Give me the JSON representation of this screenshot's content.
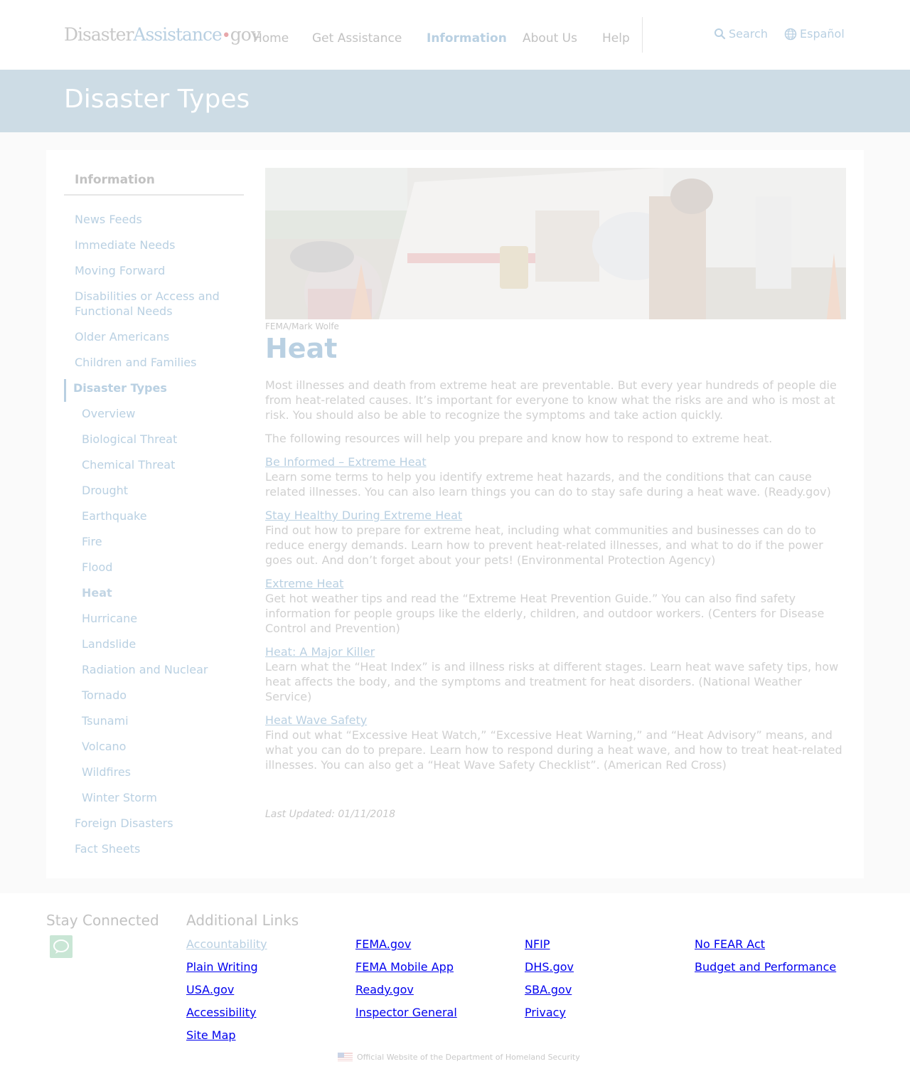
{
  "header": {
    "logo": {
      "part1": "Disaster",
      "part2": "Assistance",
      "dot": "•",
      "part3": "gov"
    },
    "nav": [
      "Home",
      "Get Assistance",
      "Information",
      "About Us",
      "Help"
    ],
    "search_label": "Search",
    "language_label": "Español"
  },
  "banner": {
    "title": "Disaster Types"
  },
  "sidebar": {
    "title": "Information",
    "items": [
      {
        "label": "News Feeds",
        "level": "top"
      },
      {
        "label": "Immediate Needs",
        "level": "top"
      },
      {
        "label": "Moving Forward",
        "level": "top"
      },
      {
        "label": "Disabilities or Access and Functional Needs",
        "level": "top"
      },
      {
        "label": "Older Americans",
        "level": "top"
      },
      {
        "label": "Children and Families",
        "level": "top"
      },
      {
        "label": "Disaster Types",
        "level": "current"
      },
      {
        "label": "Overview",
        "level": "sub"
      },
      {
        "label": "Biological Threat",
        "level": "sub"
      },
      {
        "label": "Chemical Threat",
        "level": "sub"
      },
      {
        "label": "Drought",
        "level": "sub"
      },
      {
        "label": "Earthquake",
        "level": "sub"
      },
      {
        "label": "Fire",
        "level": "sub"
      },
      {
        "label": "Flood",
        "level": "sub"
      },
      {
        "label": "Heat",
        "level": "sub-active"
      },
      {
        "label": "Hurricane",
        "level": "sub"
      },
      {
        "label": "Landslide",
        "level": "sub"
      },
      {
        "label": "Radiation and Nuclear",
        "level": "sub"
      },
      {
        "label": "Tornado",
        "level": "sub"
      },
      {
        "label": "Tsunami",
        "level": "sub"
      },
      {
        "label": "Volcano",
        "level": "sub"
      },
      {
        "label": "Wildfires",
        "level": "sub"
      },
      {
        "label": "Winter Storm",
        "level": "sub"
      },
      {
        "label": "Foreign Disasters",
        "level": "top"
      },
      {
        "label": "Fact Sheets",
        "level": "top"
      }
    ]
  },
  "main": {
    "photo_credit": "FEMA/Mark Wolfe",
    "heading": "Heat",
    "intro": "Most illnesses and death from extreme heat are preventable. But every year hundreds of people die from heat-related causes. It’s important for everyone to know what the risks are and who is most at risk. You should also be able to recognize the symptoms and take action quickly.",
    "resources_intro": "The following resources will help you prepare and know how to respond to extreme heat.",
    "resources": [
      {
        "title": "Be Informed – Extreme Heat",
        "desc": "Learn some terms to help you identify extreme heat hazards, and the conditions that can cause related illnesses. You can also learn things you can do to stay safe during a heat wave. (Ready.gov)"
      },
      {
        "title": "Stay Healthy During Extreme Heat",
        "desc": "Find out how to prepare for extreme heat, including what communities and businesses can do to reduce energy demands. Learn how to prevent heat-related illnesses, and what to do if the power goes out. And don’t forget about your pets! (Environmental Protection Agency)"
      },
      {
        "title": "Extreme Heat",
        "desc": "Get hot weather tips and read the “Extreme Heat Prevention Guide.” You can also find safety information for people groups like the elderly, children, and outdoor workers. (Centers for Disease Control and Prevention)"
      },
      {
        "title": "Heat: A Major Killer",
        "desc": "Learn what the “Heat Index” is and illness risks at different stages. Learn heat wave safety tips, how heat affects the body, and the symptoms and treatment for heat disorders. (National Weather Service)"
      },
      {
        "title": "Heat Wave Safety",
        "desc": "Find out what “Excessive Heat Watch,” “Excessive Heat Warning,” and “Heat Advisory” means, and what you can do to prepare. Learn how to respond during a heat wave, and how to treat heat-related illnesses. You can also get a “Heat Wave Safety Checklist”. (American Red Cross)"
      }
    ],
    "last_updated": "Last Updated: 01/11/2018"
  },
  "footer": {
    "stay_connected": "Stay Connected",
    "additional_links": "Additional Links",
    "links": {
      "accountability": "Accountability",
      "plain_writing": "Plain Writing",
      "usa_gov": "USA.gov",
      "accessibility": "Accessibility",
      "site_map": "Site Map",
      "fema_gov": "FEMA.gov",
      "fema_mobile": "FEMA Mobile App",
      "ready_gov": "Ready.gov",
      "dhs_gov": "DHS.gov",
      "inspector_general": "Inspector General",
      "nfip": "NFIP",
      "privacy": "Privacy",
      "no_fear": "No FEAR Act",
      "budget": "Budget and Performance",
      "sba_gov": "SBA.gov"
    },
    "dhs_note": "Official Website of the Department of Homeland Security"
  }
}
